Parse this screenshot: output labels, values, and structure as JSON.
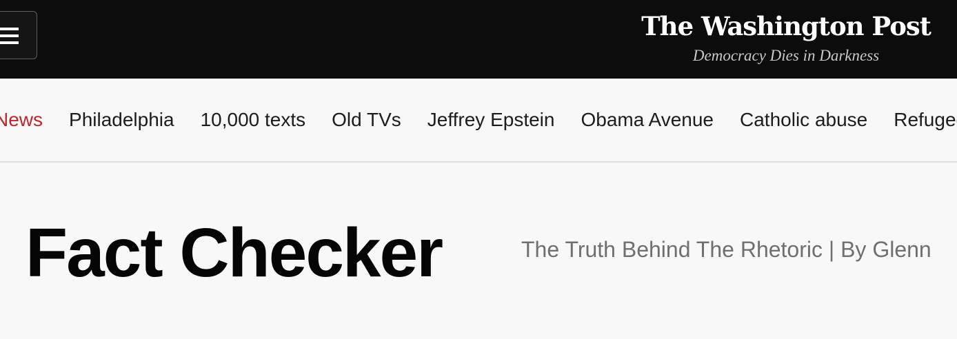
{
  "header": {
    "menu_icon": "hamburger-menu-icon",
    "logo_name": "The Washington Post",
    "logo_tagline": "Democracy Dies in Darkness",
    "background_color": "#0c0c0c"
  },
  "nav": {
    "items": [
      {
        "label": "News",
        "highlight": true
      },
      {
        "label": "Philadelphia"
      },
      {
        "label": "10,000 texts"
      },
      {
        "label": "Old TVs"
      },
      {
        "label": "Jeffrey Epstein"
      },
      {
        "label": "Obama Avenue"
      },
      {
        "label": "Catholic abuse"
      },
      {
        "label": "Refugee"
      }
    ],
    "highlight_color": "#c0262c"
  },
  "page": {
    "title": "Fact Checker",
    "subtitle": "The Truth Behind The Rhetoric | By Glenn"
  }
}
